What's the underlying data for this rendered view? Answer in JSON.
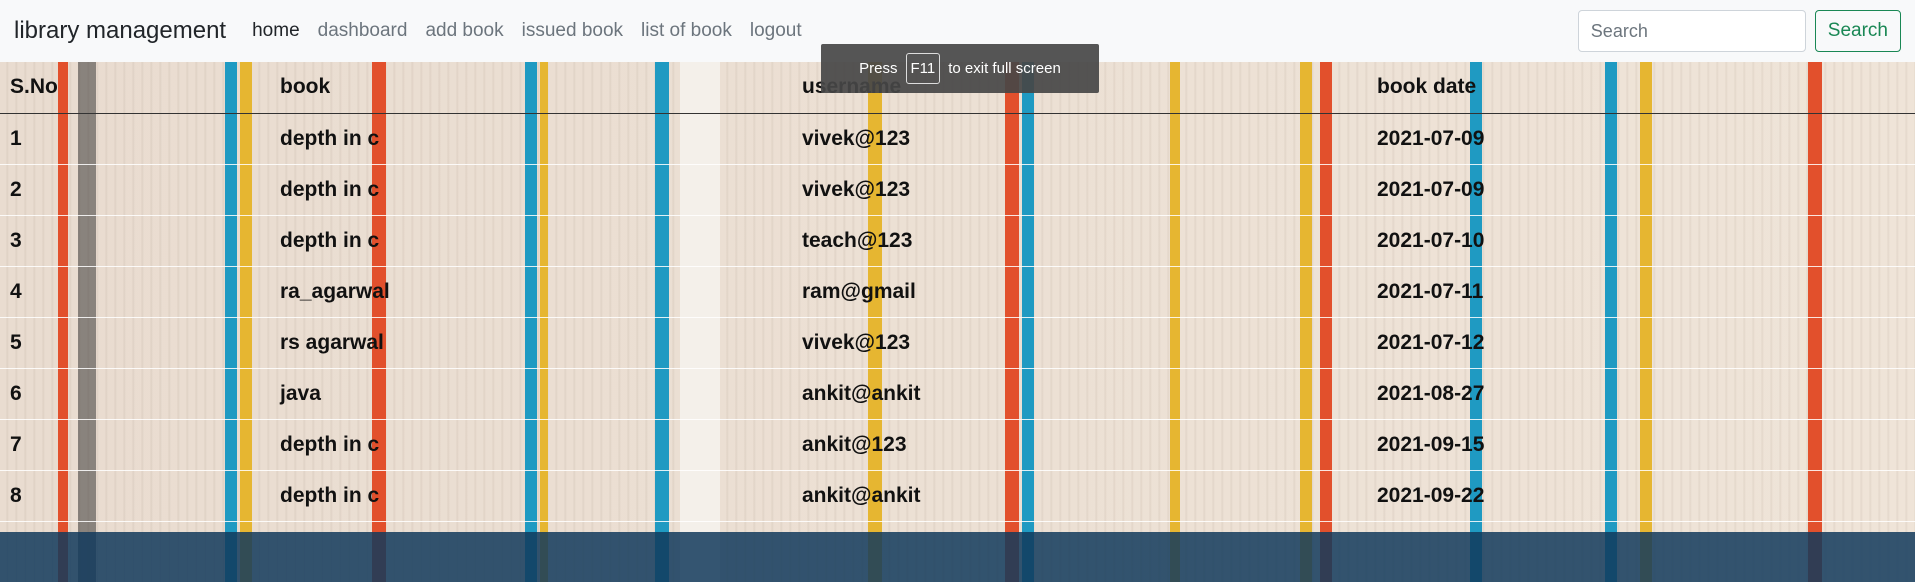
{
  "navbar": {
    "brand": "library management",
    "links": [
      {
        "label": "home",
        "active": true
      },
      {
        "label": "dashboard",
        "active": false
      },
      {
        "label": "add book",
        "active": false
      },
      {
        "label": "issued book",
        "active": false
      },
      {
        "label": "list of book",
        "active": false
      },
      {
        "label": "logout",
        "active": false
      }
    ],
    "search_placeholder": "Search",
    "search_button": "Search"
  },
  "table": {
    "headers": [
      "S.No",
      "book",
      "username",
      "book date"
    ],
    "rows": [
      [
        "1",
        "depth in c",
        "vivek@123",
        "2021-07-09"
      ],
      [
        "2",
        "depth in c",
        "vivek@123",
        "2021-07-09"
      ],
      [
        "3",
        "depth in c",
        "teach@123",
        "2021-07-10"
      ],
      [
        "4",
        "ra_agarwal",
        "ram@gmail",
        "2021-07-11"
      ],
      [
        "5",
        "rs agarwal",
        "vivek@123",
        "2021-07-12"
      ],
      [
        "6",
        "java",
        "ankit@ankit",
        "2021-08-27"
      ],
      [
        "7",
        "depth in c",
        "ankit@123",
        "2021-09-15"
      ],
      [
        "8",
        "depth in c",
        "ankit@ankit",
        "2021-09-22"
      ]
    ]
  },
  "toast": {
    "prefix": "Press",
    "key": "F11",
    "suffix": "to exit full screen"
  }
}
